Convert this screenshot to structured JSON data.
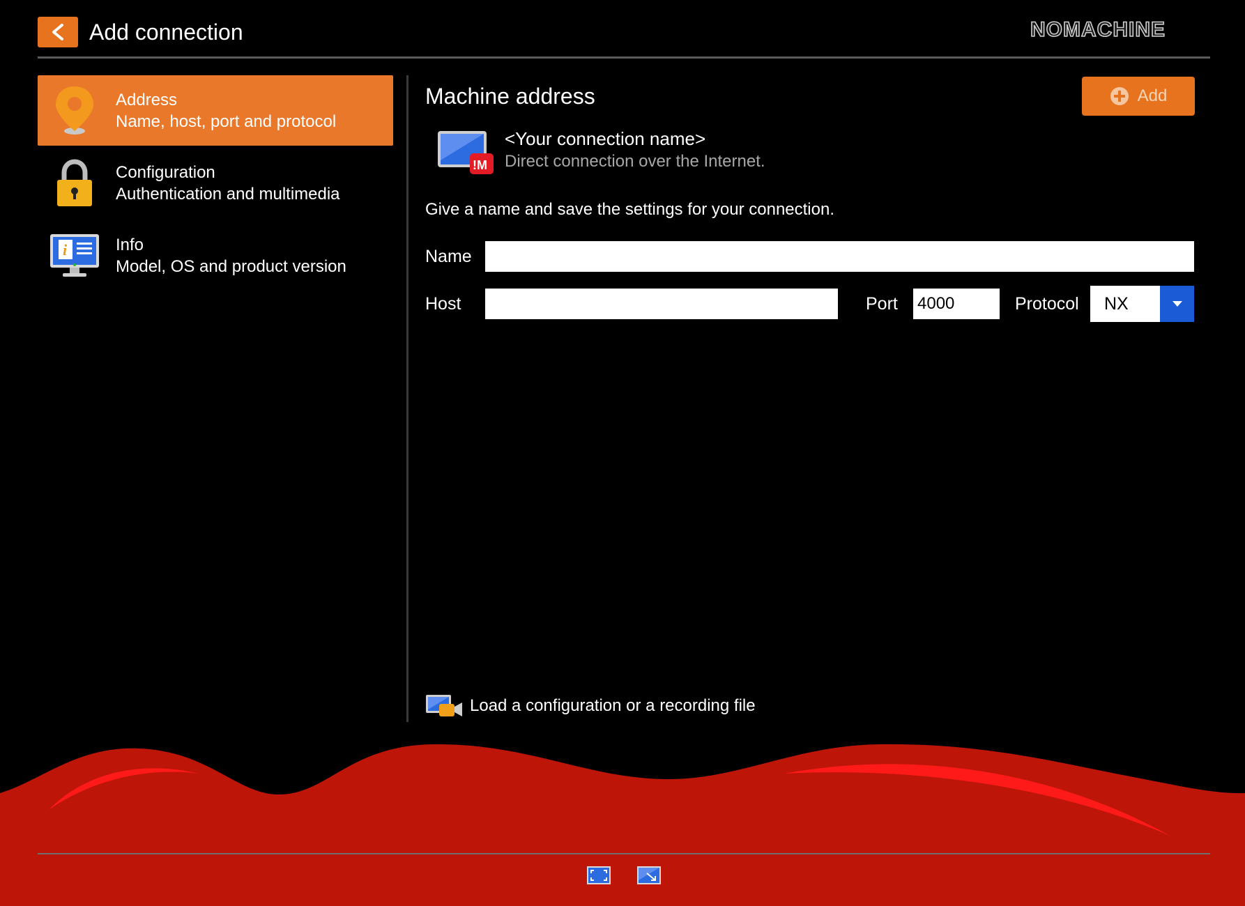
{
  "header": {
    "title": "Add connection",
    "back_icon": "chevron-left-icon",
    "logo_text": "NOMACHINE"
  },
  "sidebar": {
    "items": [
      {
        "title": "Address",
        "subtitle": "Name, host, port and protocol",
        "icon": "location-pin-icon",
        "active": true
      },
      {
        "title": "Configuration",
        "subtitle": "Authentication and multimedia",
        "icon": "padlock-icon",
        "active": false
      },
      {
        "title": "Info",
        "subtitle": "Model, OS and product version",
        "icon": "monitor-info-icon",
        "active": false
      }
    ]
  },
  "main": {
    "section_title": "Machine address",
    "add_button_label": "Add",
    "add_button_icon": "plus-circle-icon",
    "connection_preview": {
      "name": "<Your connection name>",
      "description": "Direct connection over the Internet.",
      "icon": "nx-monitor-icon"
    },
    "instructions": "Give a name and save the settings for your connection.",
    "form": {
      "name_label": "Name",
      "name_value": "",
      "host_label": "Host",
      "host_value": "",
      "port_label": "Port",
      "port_value": "4000",
      "protocol_label": "Protocol",
      "protocol_value": "NX"
    },
    "load_link": "Load a configuration or a recording file"
  },
  "footer": {
    "buttons": [
      "fullscreen-icon",
      "fit-window-icon"
    ]
  },
  "colors": {
    "accent": "#e8731f",
    "background": "#000000",
    "footer_red": "#c01a0a",
    "select_blue": "#1b5bd6"
  }
}
